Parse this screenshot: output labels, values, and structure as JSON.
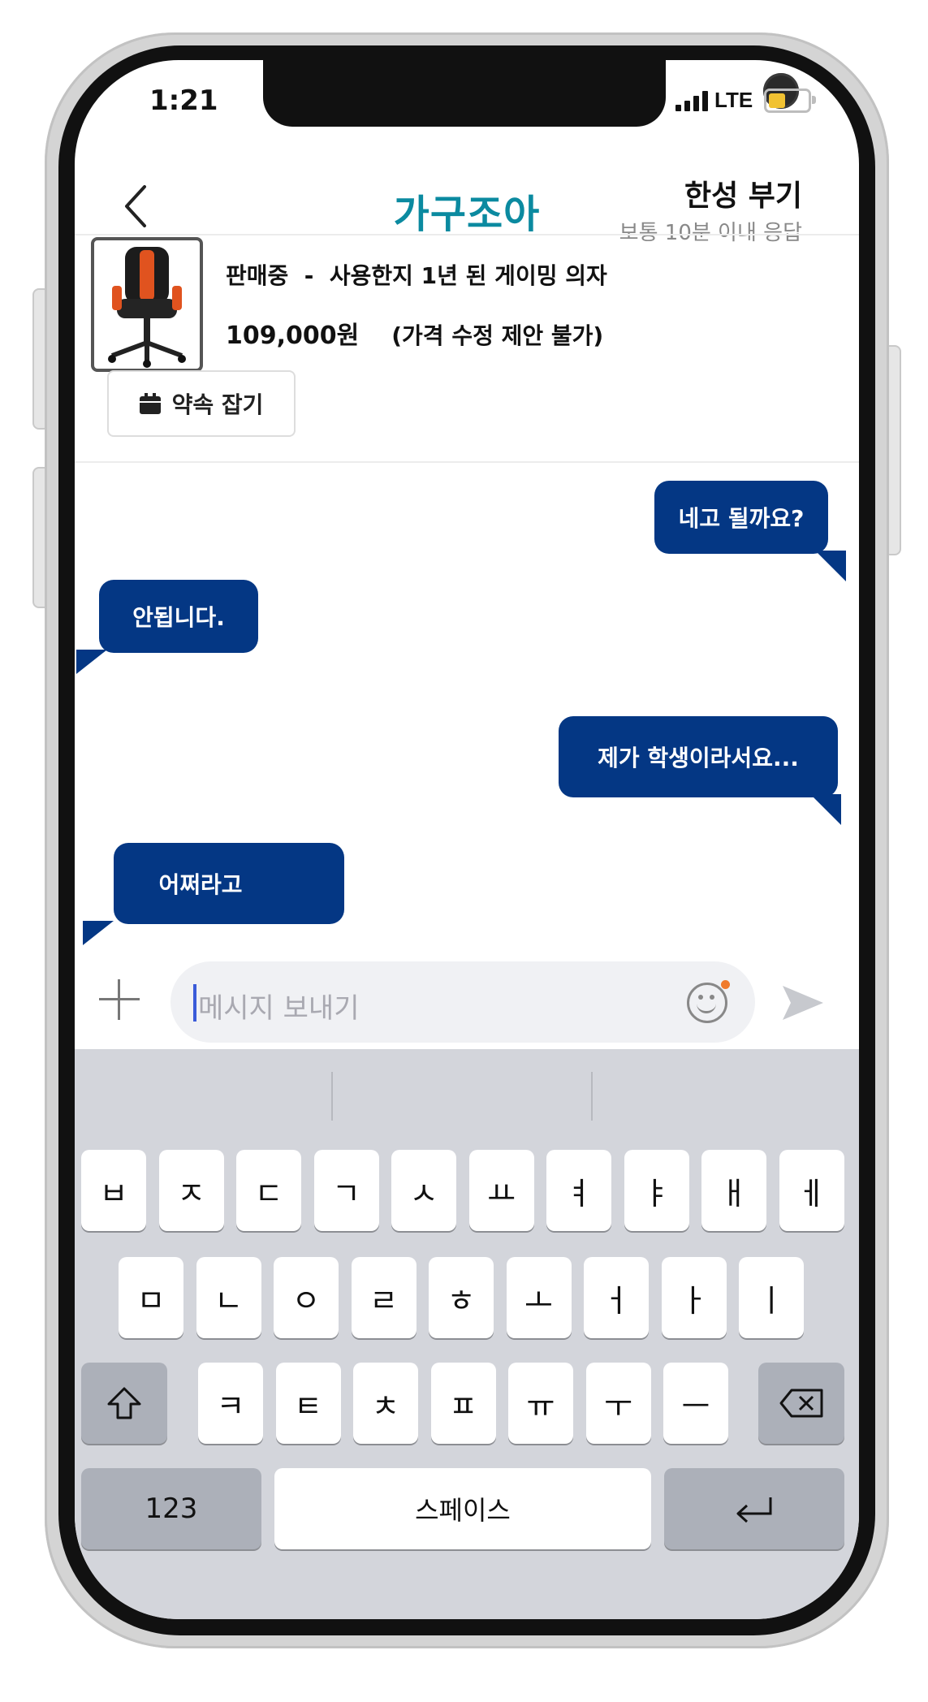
{
  "status_bar": {
    "time": "1:21",
    "network": "LTE"
  },
  "header": {
    "app_title": "가구조아",
    "seller_name": "한성 부기",
    "seller_response": "보통 10분 이내 응답"
  },
  "product": {
    "title": "판매중  -  사용한지 1년 된 게이밍 의자",
    "price": "109,000원",
    "price_note": "(가격 수정 제안 불가)",
    "appointment_button": "약속 잡기"
  },
  "messages": [
    {
      "side": "right",
      "text": "네고 될까요?"
    },
    {
      "side": "left",
      "text": "안됩니다."
    },
    {
      "side": "right",
      "text": "제가 학생이라서요..."
    },
    {
      "side": "left",
      "text": "어쩌라고"
    }
  ],
  "input": {
    "placeholder": "메시지 보내기"
  },
  "keyboard": {
    "row1": [
      "ㅂ",
      "ㅈ",
      "ㄷ",
      "ㄱ",
      "ㅅ",
      "ㅛ",
      "ㅕ",
      "ㅑ",
      "ㅐ",
      "ㅔ"
    ],
    "row2": [
      "ㅁ",
      "ㄴ",
      "ㅇ",
      "ㄹ",
      "ㅎ",
      "ㅗ",
      "ㅓ",
      "ㅏ",
      "ㅣ"
    ],
    "row3": [
      "ㅋ",
      "ㅌ",
      "ㅊ",
      "ㅍ",
      "ㅠ",
      "ㅜ",
      "ㅡ"
    ],
    "numbers_key": "123",
    "space_key": "스페이스"
  },
  "colors": {
    "brand_title": "#0b8aa0",
    "bubble": "#043784",
    "emoji_badge": "#f07a2b"
  }
}
